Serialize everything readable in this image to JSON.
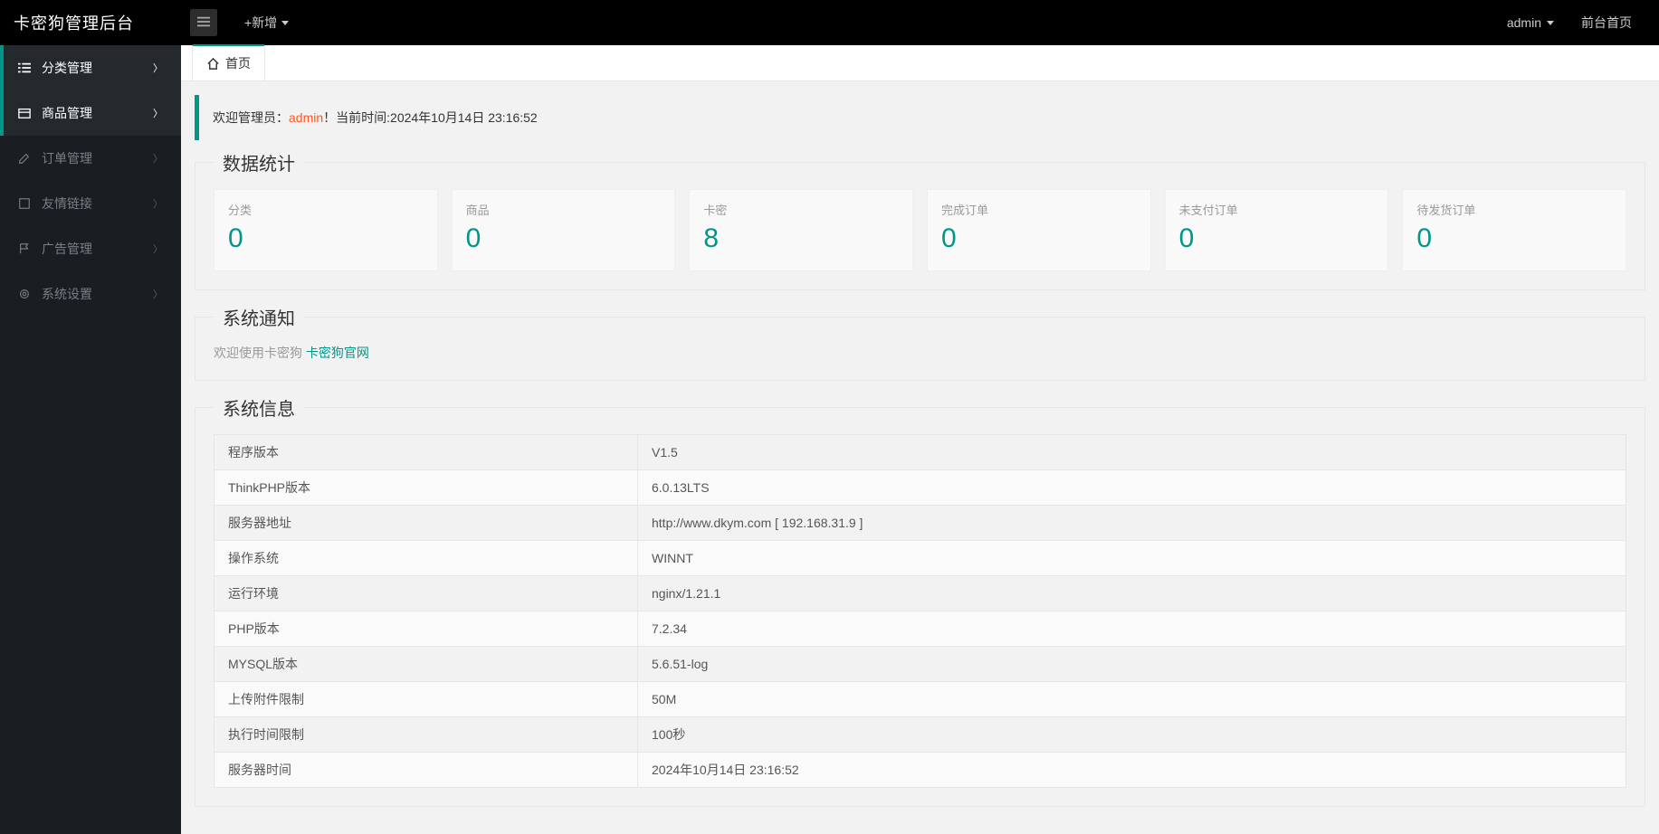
{
  "header": {
    "logo": "卡密狗管理后台",
    "add_new": "+新增",
    "user": "admin",
    "front_site": "前台首页"
  },
  "sidebar": {
    "items": [
      {
        "label": "分类管理",
        "icon": "list"
      },
      {
        "label": "商品管理",
        "icon": "box"
      },
      {
        "label": "订单管理",
        "icon": "edit"
      },
      {
        "label": "友情链接",
        "icon": "link"
      },
      {
        "label": "广告管理",
        "icon": "flag"
      },
      {
        "label": "系统设置",
        "icon": "gear"
      }
    ]
  },
  "tabs": {
    "home": "首页"
  },
  "welcome": {
    "prefix": "欢迎管理员：",
    "admin": "admin",
    "suffix": "！当前时间:2024年10月14日 23:16:52"
  },
  "stats": {
    "title": "数据统计",
    "cards": [
      {
        "label": "分类",
        "value": "0"
      },
      {
        "label": "商品",
        "value": "0"
      },
      {
        "label": "卡密",
        "value": "8"
      },
      {
        "label": "完成订单",
        "value": "0"
      },
      {
        "label": "未支付订单",
        "value": "0"
      },
      {
        "label": "待发货订单",
        "value": "0"
      }
    ]
  },
  "notice": {
    "title": "系统通知",
    "text": "欢迎使用卡密狗",
    "link": "卡密狗官网"
  },
  "sysinfo": {
    "title": "系统信息",
    "rows": [
      {
        "k": "程序版本",
        "v": "V1.5"
      },
      {
        "k": "ThinkPHP版本",
        "v": "6.0.13LTS"
      },
      {
        "k": "服务器地址",
        "v": "http://www.dkym.com [ 192.168.31.9 ]"
      },
      {
        "k": "操作系统",
        "v": "WINNT"
      },
      {
        "k": "运行环境",
        "v": "nginx/1.21.1"
      },
      {
        "k": "PHP版本",
        "v": "7.2.34"
      },
      {
        "k": "MYSQL版本",
        "v": "5.6.51-log"
      },
      {
        "k": "上传附件限制",
        "v": "50M"
      },
      {
        "k": "执行时间限制",
        "v": "100秒"
      },
      {
        "k": "服务器时间",
        "v": "2024年10月14日 23:16:52"
      }
    ]
  }
}
